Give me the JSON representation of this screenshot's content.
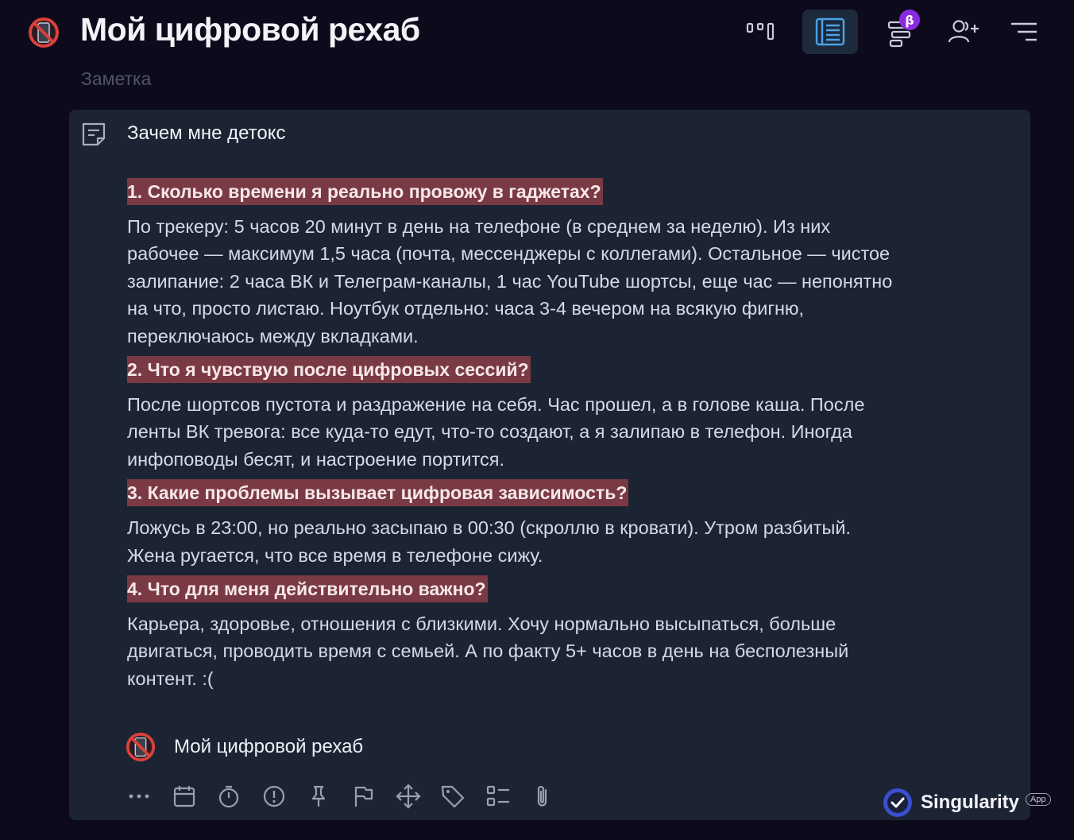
{
  "header": {
    "title": "Мой цифровой рехаб",
    "subtitle": "Заметка",
    "buttons": [
      {
        "icon": "kanban-columns-icon",
        "active": false
      },
      {
        "icon": "list-view-icon",
        "active": true
      },
      {
        "icon": "gantt-icon",
        "active": false,
        "badge": "β"
      },
      {
        "icon": "add-user-icon",
        "active": false
      },
      {
        "icon": "menu-icon",
        "active": false
      }
    ]
  },
  "note": {
    "title": "Зачем мне детокс",
    "sections": [
      {
        "question": "1. Сколько времени я реально провожу в гаджетах?",
        "answer_lines": [
          "По трекеру: 5 часов 20 минут в день на телефоне (в среднем за неделю). Из них",
          "рабочее — максимум 1,5 часа (почта, мессенджеры с коллегами). Остальное — чистое",
          "залипание: 2 часа ВК и Телеграм-каналы, 1 час YouTube шортсы, еще час — непонятно",
          "на что, просто листаю. Ноутбук отдельно: часа 3-4 вечером на всякую фигню,",
          "переключаюсь между вкладками."
        ]
      },
      {
        "question": "2. Что я чувствую после цифровых сессий?",
        "answer_lines": [
          "После шортсов пустота и раздражение на себя. Час прошел, а в голове каша. После",
          "ленты ВК тревога: все куда-то едут, что-то создают, а я залипаю в телефон. Иногда",
          "инфоповоды бесят, и настроение портится."
        ]
      },
      {
        "question": "3. Какие проблемы вызывает цифровая зависимость?",
        "answer_lines": [
          "Ложусь в 23:00, но реально засыпаю в 00:30 (скроллю в кровати). Утром разбитый.",
          "Жена ругается, что все время в телефоне сижу."
        ]
      },
      {
        "question": "4. Что для меня действительно важно?",
        "answer_lines": [
          "Карьера, здоровье, отношения с близкими. Хочу нормально высыпаться, больше",
          "двигаться, проводить время с семьей. А по факту 5+ часов в день на бесполезный",
          "контент. :("
        ]
      }
    ],
    "project": "Мой цифровой рехаб",
    "toolbar": [
      "more-icon",
      "calendar-icon",
      "timer-icon",
      "priority-icon",
      "pin-icon",
      "flag-icon",
      "move-icon",
      "tag-icon",
      "checklist-icon",
      "attachment-icon"
    ]
  },
  "brand": {
    "name": "Singularity",
    "tag": "App"
  },
  "colors": {
    "background": "#0d0a1c",
    "card": "#1c2434",
    "highlight": "#7a3a44",
    "accent": "#4aa3e8",
    "beta_badge": "#8a2be2"
  }
}
